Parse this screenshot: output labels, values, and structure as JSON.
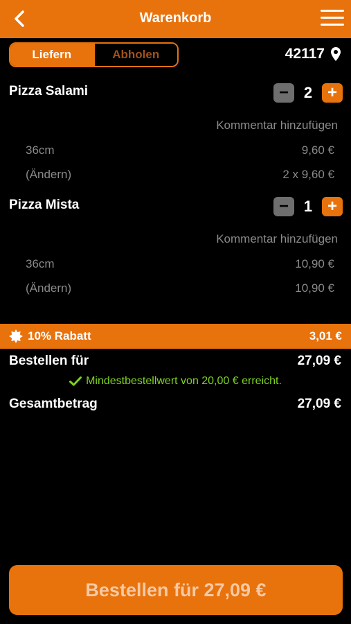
{
  "header": {
    "title": "Warenkorb"
  },
  "delivery_toggle": {
    "deliver_label": "Liefern",
    "pickup_label": "Abholen",
    "selected": "Liefern"
  },
  "location": {
    "postal_code": "42117"
  },
  "items": [
    {
      "name": "Pizza Salami",
      "quantity": "2",
      "comment_label": "Kommentar hinzufügen",
      "size": "36cm",
      "size_price": "9,60 €",
      "change_label": "(Ändern)",
      "line_total": "2 x 9,60 €"
    },
    {
      "name": "Pizza Mista",
      "quantity": "1",
      "comment_label": "Kommentar hinzufügen",
      "size": "36cm",
      "size_price": "10,90 €",
      "change_label": "(Ändern)",
      "line_total": "10,90 €"
    }
  ],
  "discount": {
    "label": "10% Rabatt",
    "amount": "3,01 €"
  },
  "order_for": {
    "label": "Bestellen für",
    "amount": "27,09 €"
  },
  "min_order_note": "Mindestbestellwert von 20,00 € erreicht.",
  "grand_total": {
    "label": "Gesamtbetrag",
    "amount": "27,09 €"
  },
  "order_button": {
    "label": "Bestellen für 27,09 €"
  },
  "colors": {
    "accent": "#e8720c",
    "muted": "#8a8a8a",
    "success": "#7ed321",
    "background": "#000000"
  }
}
